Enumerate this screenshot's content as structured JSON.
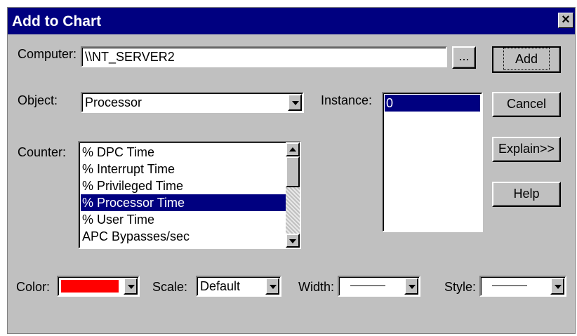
{
  "window": {
    "title": "Add to Chart"
  },
  "labels": {
    "computer": "Computer:",
    "object": "Object:",
    "counter": "Counter:",
    "instance": "Instance:",
    "color": "Color:",
    "scale": "Scale:",
    "width": "Width:",
    "style": "Style:"
  },
  "computer_value": "\\\\NT_SERVER2",
  "browse_label": "...",
  "object_value": "Processor",
  "counters": [
    "% DPC Time",
    "% Interrupt Time",
    "% Privileged Time",
    "% Processor Time",
    "% User Time",
    "APC Bypasses/sec"
  ],
  "selected_counter": "% Processor Time",
  "instances": [
    "0"
  ],
  "scale_value": "Default",
  "colors": {
    "chart_color": "#ff0000",
    "selection": "#000080",
    "face": "#c0c0c0"
  },
  "buttons": {
    "add": "Add",
    "cancel": "Cancel",
    "explain": "Explain>>",
    "help": "Help"
  }
}
